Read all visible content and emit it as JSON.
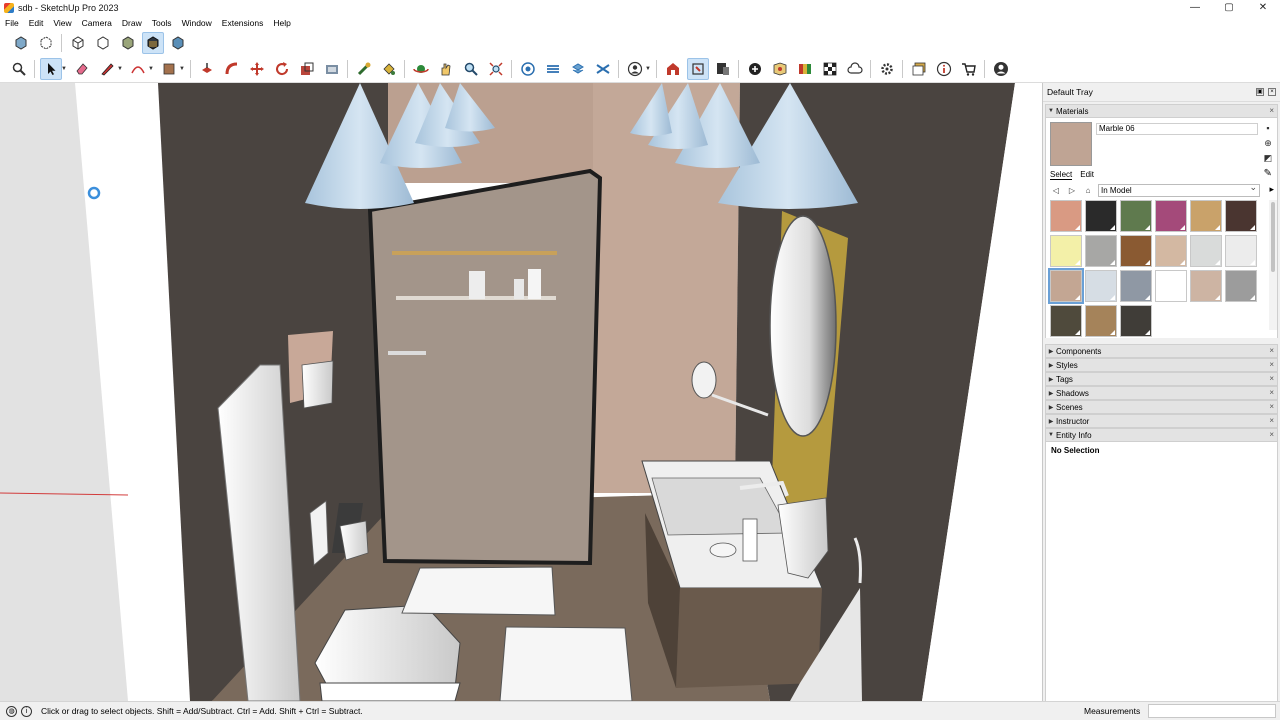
{
  "window": {
    "title": "sdb - SketchUp Pro 2023",
    "controls": [
      "—",
      "▢",
      "✕"
    ]
  },
  "menu": [
    "File",
    "Edit",
    "View",
    "Camera",
    "Draw",
    "Tools",
    "Window",
    "Extensions",
    "Help"
  ],
  "toolbar1_icons": [
    "xray-icon",
    "back-edges-icon",
    "wireframe-icon",
    "hidden-line-icon",
    "shaded-icon",
    "shaded-textures-icon",
    "monochrome-icon"
  ],
  "toolbar2_icons": [
    "search-icon",
    "select-icon",
    "eraser-icon",
    "pencil-line-icon",
    "arc-icon",
    "rectangle-icon",
    "push-pull-icon",
    "follow-me-icon",
    "move-icon",
    "rotate-icon",
    "scale-icon",
    "offset-icon",
    "tape-measure-icon",
    "paint-bucket-icon",
    "orbit-icon",
    "pan-icon",
    "zoom-icon",
    "zoom-extents-icon",
    "section-plane-icon",
    "section-fill-icon",
    "section-cut-icon",
    "section-display-icon",
    "user-icon",
    "warehouse-icon",
    "extension-warehouse-icon",
    "layout-icon",
    "add-location-icon",
    "geo-location-icon",
    "materials-library-icon",
    "checker-icon",
    "cloud-icon",
    "settings-icon",
    "trimble-connect-icon",
    "info-icon",
    "cart-icon",
    "account-icon"
  ],
  "tray": {
    "title": "Default Tray",
    "materials": {
      "header": "Materials",
      "current_name": "Marble 06",
      "tabs": [
        "Select",
        "Edit"
      ],
      "collection": "In Model",
      "swatch_colors": [
        "#d99a83",
        "#2a2a2a",
        "#5f7a4e",
        "#a44a7a",
        "#c9a26a",
        "#4a3530",
        "#f3f0a8",
        "#a7a7a5",
        "#8a5a32",
        "#d3b8a2",
        "#d9dbda",
        "#ececec",
        "#c3a693",
        "#d6dde4",
        "#8f98a4",
        "#ffffff",
        "#cdb4a3",
        "#9c9c9c",
        "#4f4a3c",
        "#a5835a",
        "#403d38"
      ],
      "selected_swatch": 12
    },
    "panels": [
      "Components",
      "Styles",
      "Tags",
      "Shadows",
      "Scenes",
      "Instructor"
    ],
    "entity_info": {
      "header": "Entity Info",
      "selection": "No Selection"
    }
  },
  "status": {
    "hint": "Click or drag to select objects. Shift = Add/Subtract. Ctrl = Add. Shift + Ctrl = Subtract.",
    "measurements_label": "Measurements",
    "measurements_value": ""
  }
}
